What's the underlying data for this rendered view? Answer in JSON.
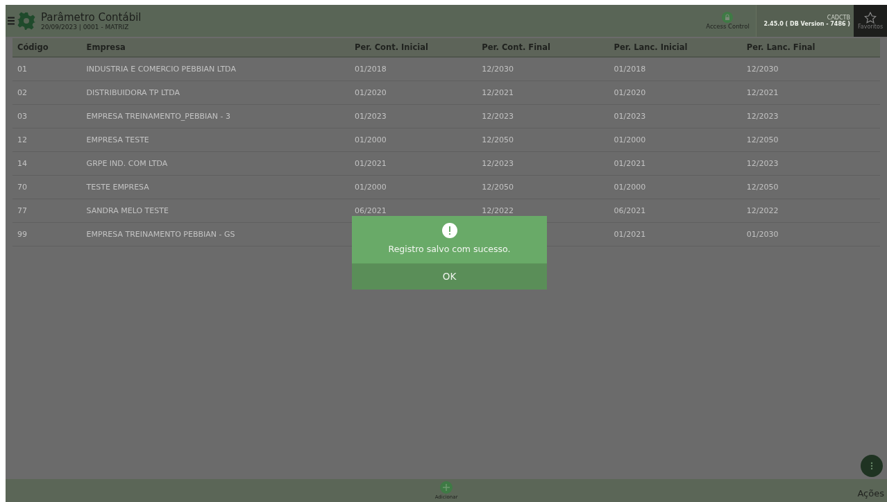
{
  "header": {
    "title": "Parâmetro Contábil",
    "subtitle": "20/09/2023 | 0001 - MATRIZ",
    "access_control": "Access Control",
    "program_code": "CADCTB",
    "version": "2.45.0 ( DB Version - 7486 )",
    "favorites": "Favoritos"
  },
  "table": {
    "columns": [
      "Código",
      "Empresa",
      "Per. Cont. Inicial",
      "Per. Cont. Final",
      "Per. Lanc. Inicial",
      "Per. Lanc. Final"
    ],
    "rows": [
      {
        "codigo": "01",
        "empresa": "INDUSTRIA E COMERCIO PEBBIAN LTDA",
        "cont_inicial": "01/2018",
        "cont_final": "12/2030",
        "lanc_inicial": "01/2018",
        "lanc_final": "12/2030"
      },
      {
        "codigo": "02",
        "empresa": "DISTRIBUIDORA TP LTDA",
        "cont_inicial": "01/2020",
        "cont_final": "12/2021",
        "lanc_inicial": "01/2020",
        "lanc_final": "12/2021"
      },
      {
        "codigo": "03",
        "empresa": "EMPRESA TREINAMENTO_PEBBIAN - 3",
        "cont_inicial": "01/2023",
        "cont_final": "12/2023",
        "lanc_inicial": "01/2023",
        "lanc_final": "12/2023"
      },
      {
        "codigo": "12",
        "empresa": "EMPRESA TESTE",
        "cont_inicial": "01/2000",
        "cont_final": "12/2050",
        "lanc_inicial": "01/2000",
        "lanc_final": "12/2050"
      },
      {
        "codigo": "14",
        "empresa": "GRPE IND. COM LTDA",
        "cont_inicial": "01/2021",
        "cont_final": "12/2023",
        "lanc_inicial": "01/2021",
        "lanc_final": "12/2023"
      },
      {
        "codigo": "70",
        "empresa": "TESTE EMPRESA",
        "cont_inicial": "01/2000",
        "cont_final": "12/2050",
        "lanc_inicial": "01/2000",
        "lanc_final": "12/2050"
      },
      {
        "codigo": "77",
        "empresa": "SANDRA MELO TESTE",
        "cont_inicial": "06/2021",
        "cont_final": "12/2022",
        "lanc_inicial": "06/2021",
        "lanc_final": "12/2022"
      },
      {
        "codigo": "99",
        "empresa": "EMPRESA TREINAMENTO PEBBIAN - GS",
        "lanc_inicial": "01/2021",
        "lanc_final": "01/2030"
      }
    ]
  },
  "dialog": {
    "message": "Registro salvo com sucesso.",
    "button": "OK"
  },
  "bottom_bar": {
    "add": "Adicionar",
    "actions": "Ações"
  }
}
